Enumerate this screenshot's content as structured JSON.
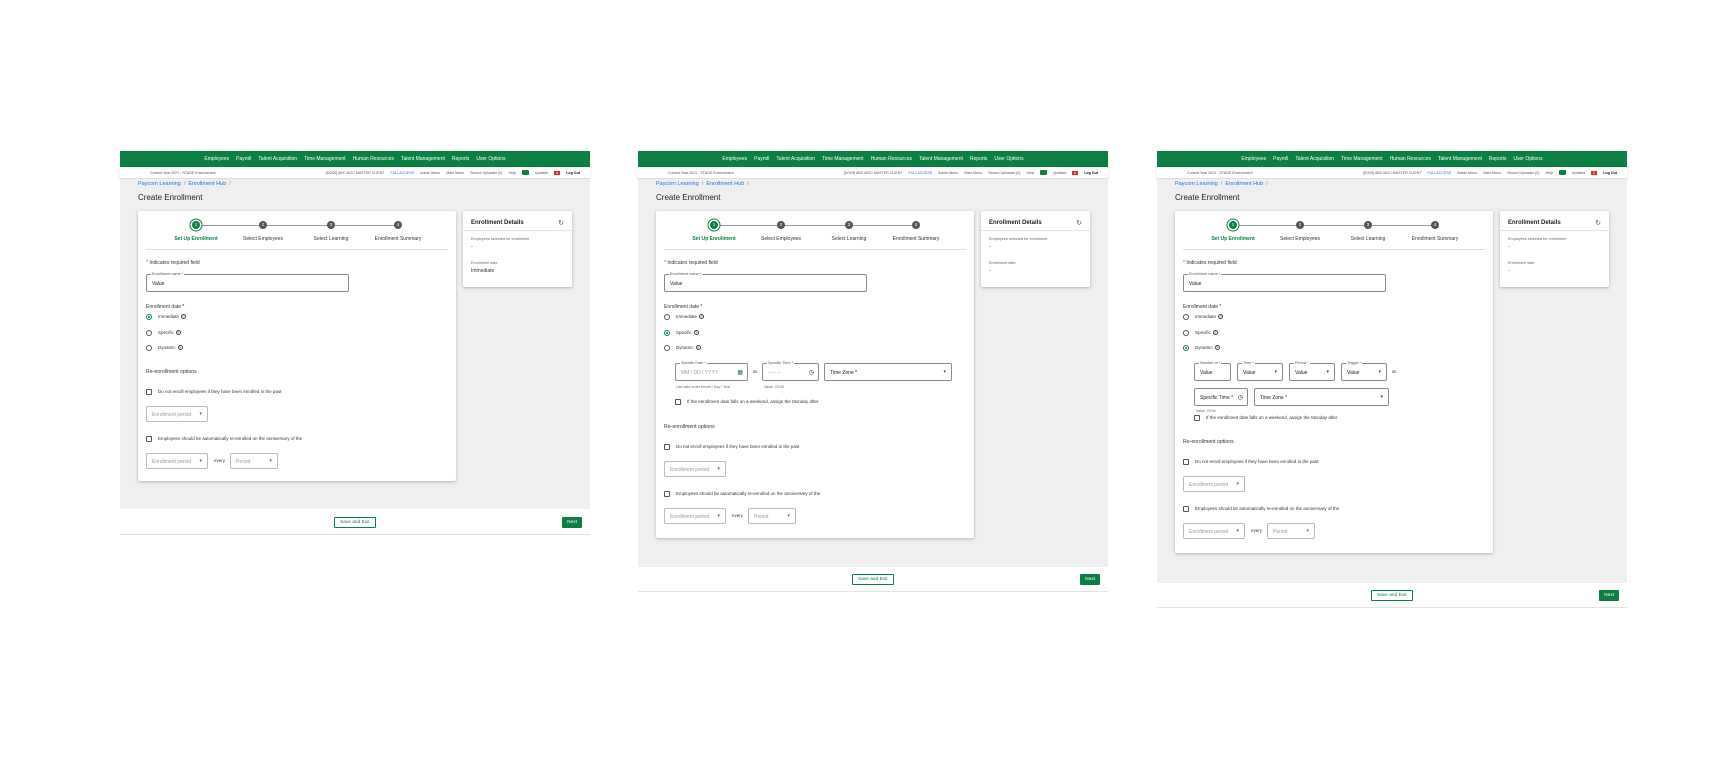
{
  "nav": {
    "items": [
      "Employees",
      "Payroll",
      "Talent Acquisition",
      "Time Management",
      "Human Resources",
      "Talent Management",
      "Reports",
      "User Options"
    ]
  },
  "subbar": {
    "env": "Current Year 2021 - STAGE Environment",
    "client": "[DG09] ABC MOC MASTER CLIENT",
    "fullaccess": "FULLACCESS",
    "admin_menu": "Admin Menu",
    "main_menu": "Main Menu",
    "secure_uploader": "Secure Uploader (0)",
    "help": "Help",
    "updates": "Updates",
    "updates_count": "0",
    "logout": "Log Out"
  },
  "breadcrumb": {
    "root": "Paycom Learning",
    "hub": "Enrollment Hub",
    "sep": "/"
  },
  "page_title": "Create Enrollment",
  "steps": [
    {
      "num": "1",
      "label": "Set Up Enrollment"
    },
    {
      "num": "2",
      "label": "Select Employees"
    },
    {
      "num": "3",
      "label": "Select Learning"
    },
    {
      "num": "4",
      "label": "Enrollment Summary"
    }
  ],
  "form": {
    "required_note": "Indicates required field",
    "required_mark": "*",
    "name_label": "Enrollment name *",
    "name_value": "Value",
    "date_label": "Enrollment date *",
    "opt_immediate": "Immediate",
    "opt_specific": "Specific",
    "opt_dynamic": "Dynamic",
    "help_glyph": "?",
    "reenroll_title": "Re-enrollment options",
    "chk_no_enroll": "Do not enroll employees if they have been enrolled in the past",
    "enroll_period": "Enrollment period",
    "chk_auto": "Employees should be automatically re-enrolled on the anniversary of the",
    "every": "every",
    "period": "Period",
    "weekend_note": "If the enrollment date falls on a weekend, assign the Monday after"
  },
  "specific": {
    "date_label": "Specific Date *",
    "date_ph": "MM / DD / YYYY",
    "date_hint": "Use date order Month / Day / Year",
    "at": "at",
    "time_label": "Specific Time *",
    "time_ph": "--:-- --",
    "time_hint": "Value: 23:06",
    "tz_label": "Time Zone *"
  },
  "dynamic": {
    "number_label": "Number of *",
    "time_label": "Time *",
    "period_label": "Period *",
    "trigger_label": "Trigger *",
    "value": "Value",
    "at": "at",
    "specific_time": "Specific Time *",
    "tz_label": "Time Zone *",
    "time_hint": "Value: 23:0e"
  },
  "details": {
    "title": "Enrollment Details",
    "employees_label": "Employees selected for enrollment",
    "employees_value": "-",
    "date_label": "Enrollment date",
    "date_value_immediate": "Immediate",
    "date_value_empty": "-"
  },
  "footer": {
    "save_exit": "Save and Exit",
    "next": "Next"
  },
  "colors": {
    "brand": "#0b8043",
    "background": "#efefef"
  }
}
